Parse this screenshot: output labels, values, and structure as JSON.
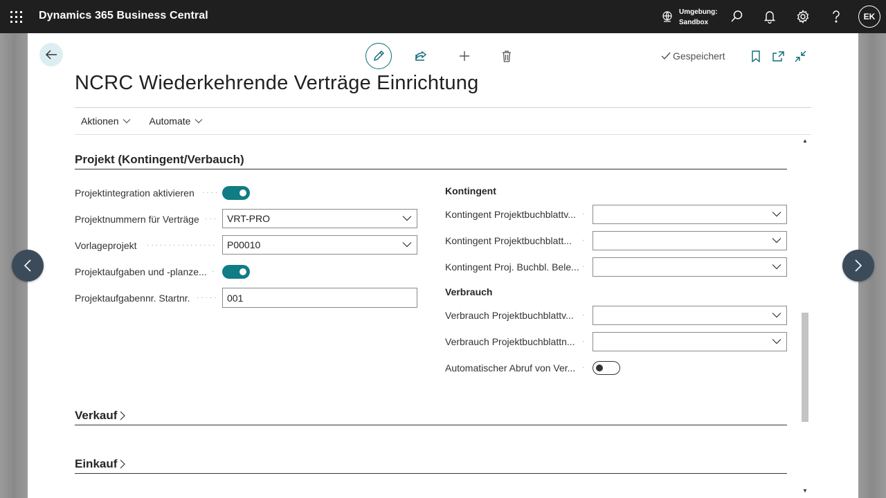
{
  "app": {
    "title": "Dynamics 365 Business Central"
  },
  "environment": {
    "label": "Umgebung:",
    "value": "Sandbox"
  },
  "user": {
    "initials": "EK"
  },
  "status": {
    "saved": "Gespeichert"
  },
  "page": {
    "title": "NCRC Wiederkehrende Verträge Einrichtung"
  },
  "menu": [
    {
      "label": "Aktionen"
    },
    {
      "label": "Automate"
    }
  ],
  "section_project": {
    "title": "Projekt (Kontingent/Verbauch)",
    "left_fields": [
      {
        "label": "Projektintegration aktivieren",
        "type": "toggle",
        "value": true
      },
      {
        "label": "Projektnummern für Verträge",
        "type": "select",
        "value": "VRT-PRO"
      },
      {
        "label": "Vorlageprojekt",
        "type": "select",
        "value": "P00010"
      },
      {
        "label": "Projektaufgaben und -planze...",
        "type": "toggle",
        "value": true
      },
      {
        "label": "Projektaufgabennr. Startnr.",
        "type": "text",
        "value": "001"
      }
    ],
    "kontingent": {
      "title": "Kontingent",
      "fields": [
        {
          "label": "Kontingent Projektbuchblattv...",
          "value": ""
        },
        {
          "label": "Kontingent Projektbuchblatt...",
          "value": ""
        },
        {
          "label": "Kontingent Proj. Buchbl. Bele...",
          "value": ""
        }
      ]
    },
    "verbrauch": {
      "title": "Verbrauch",
      "fields": [
        {
          "label": "Verbrauch Projektbuchblattv...",
          "type": "select",
          "value": ""
        },
        {
          "label": "Verbrauch Projektbuchblattn...",
          "type": "select",
          "value": ""
        },
        {
          "label": "Automatischer Abruf von Ver...",
          "type": "toggle",
          "value": false
        }
      ]
    }
  },
  "section_verkauf": {
    "title": "Verkauf"
  },
  "section_einkauf": {
    "title": "Einkauf"
  },
  "colors": {
    "accent": "#107c85",
    "topbar": "#1f1f1f",
    "nav": "#3b4b59"
  }
}
